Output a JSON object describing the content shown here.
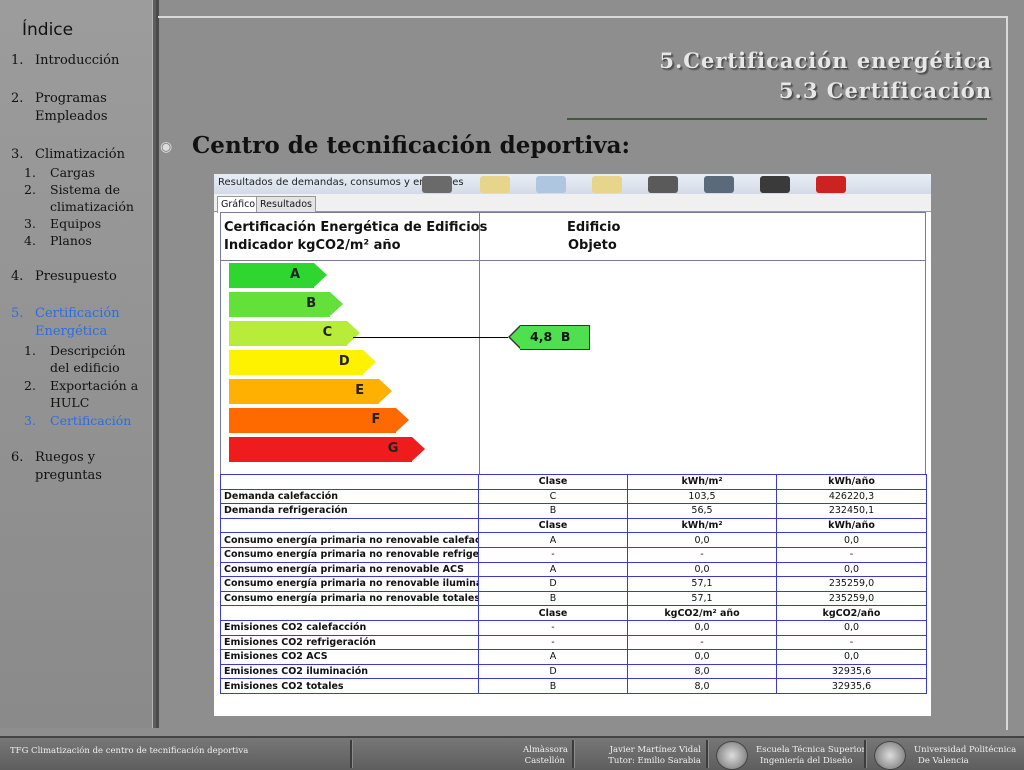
{
  "sidebar": {
    "title": "Índice",
    "items": [
      {
        "num": "1.",
        "label": "Introducción"
      },
      {
        "num": "2.",
        "label": "Programas Empleados"
      },
      {
        "num": "3.",
        "label": "Climatización",
        "subitems": [
          {
            "num": "1.",
            "label": "Cargas"
          },
          {
            "num": "2.",
            "label": "Sistema de climatización"
          },
          {
            "num": "3.",
            "label": "Equipos"
          },
          {
            "num": "4.",
            "label": "Planos"
          }
        ]
      },
      {
        "num": "4.",
        "label": "Presupuesto"
      },
      {
        "num": "5.",
        "label": "Certificación Energética",
        "active": true,
        "subitems": [
          {
            "num": "1.",
            "label": "Descripción del edificio"
          },
          {
            "num": "2.",
            "label": "Exportación a HULC"
          },
          {
            "num": "3.",
            "label": "Certificación",
            "active": true
          }
        ]
      },
      {
        "num": "6.",
        "label": "Ruegos y preguntas"
      }
    ]
  },
  "slide": {
    "title_line1": "5.Certificación energética",
    "title_line2": "5.3 Certificación",
    "heading": "Centro de tecnificación deportiva:",
    "bullet_icon": "circle-bullet-icon"
  },
  "app": {
    "window_title": "Resultados de demandas, consumos y emisiones",
    "tabs": [
      "Gráfico",
      "Resultados"
    ],
    "selected_tab": "Gráfico",
    "cert_title_line1": "Certificación Energética de Edificios",
    "cert_title_line2": "Indicador kgCO2/m² año",
    "edificio_label": "Edificio",
    "objeto_label": "Objeto",
    "scale": [
      {
        "letter": "A",
        "color": "#2fd62f"
      },
      {
        "letter": "B",
        "color": "#63e03a"
      },
      {
        "letter": "C",
        "color": "#b8ec3a"
      },
      {
        "letter": "D",
        "color": "#fff200"
      },
      {
        "letter": "E",
        "color": "#ffb000"
      },
      {
        "letter": "F",
        "color": "#ff6a00"
      },
      {
        "letter": "G",
        "color": "#ee1c1c"
      }
    ],
    "indicator": {
      "value": "4,8",
      "class": "B",
      "color": "#4ee04e"
    },
    "table": {
      "sections": [
        {
          "headers": [
            "",
            "Clase",
            "kWh/m²",
            "kWh/año"
          ],
          "rows": [
            [
              "Demanda calefacción",
              "C",
              "103,5",
              "426220,3"
            ],
            [
              "Demanda refrigeración",
              "B",
              "56,5",
              "232450,1"
            ]
          ]
        },
        {
          "headers": [
            "",
            "Clase",
            "kWh/m²",
            "kWh/año"
          ],
          "rows": [
            [
              "Consumo energía primaria no renovable calefacción",
              "A",
              "0,0",
              "0,0"
            ],
            [
              "Consumo energía primaria no renovable refrigeración",
              "-",
              "-",
              "-"
            ],
            [
              "Consumo energía primaria no renovable ACS",
              "A",
              "0,0",
              "0,0"
            ],
            [
              "Consumo energía primaria no renovable iluminación",
              "D",
              "57,1",
              "235259,0"
            ],
            [
              "Consumo energía primaria no renovable totales",
              "B",
              "57,1",
              "235259,0"
            ]
          ]
        },
        {
          "headers": [
            "",
            "Clase",
            "kgCO2/m² año",
            "kgCO2/año"
          ],
          "rows": [
            [
              "Emisiones CO2 calefacción",
              "-",
              "0,0",
              "0,0"
            ],
            [
              "Emisiones CO2 refrigeración",
              "-",
              "-",
              "-"
            ],
            [
              "Emisiones CO2 ACS",
              "A",
              "0,0",
              "0,0"
            ],
            [
              "Emisiones CO2 iluminación",
              "D",
              "8,0",
              "32935,6"
            ],
            [
              "Emisiones CO2 totales",
              "B",
              "8,0",
              "32935,6"
            ]
          ]
        }
      ]
    }
  },
  "footer": {
    "project": "TFG Climatización de centro de tecnificación deportiva",
    "location_line1": "Almàssora",
    "location_line2": "Castellón",
    "author_line1": "Javier Martínez Vidal",
    "author_line2": "Tutor: Emilio Sarabia",
    "school_line1": "Escuela Técnica Superior",
    "school_line2": "Ingeniería del Diseño",
    "university_line1": "Universidad Politécnica",
    "university_line2": "De Valencia"
  }
}
